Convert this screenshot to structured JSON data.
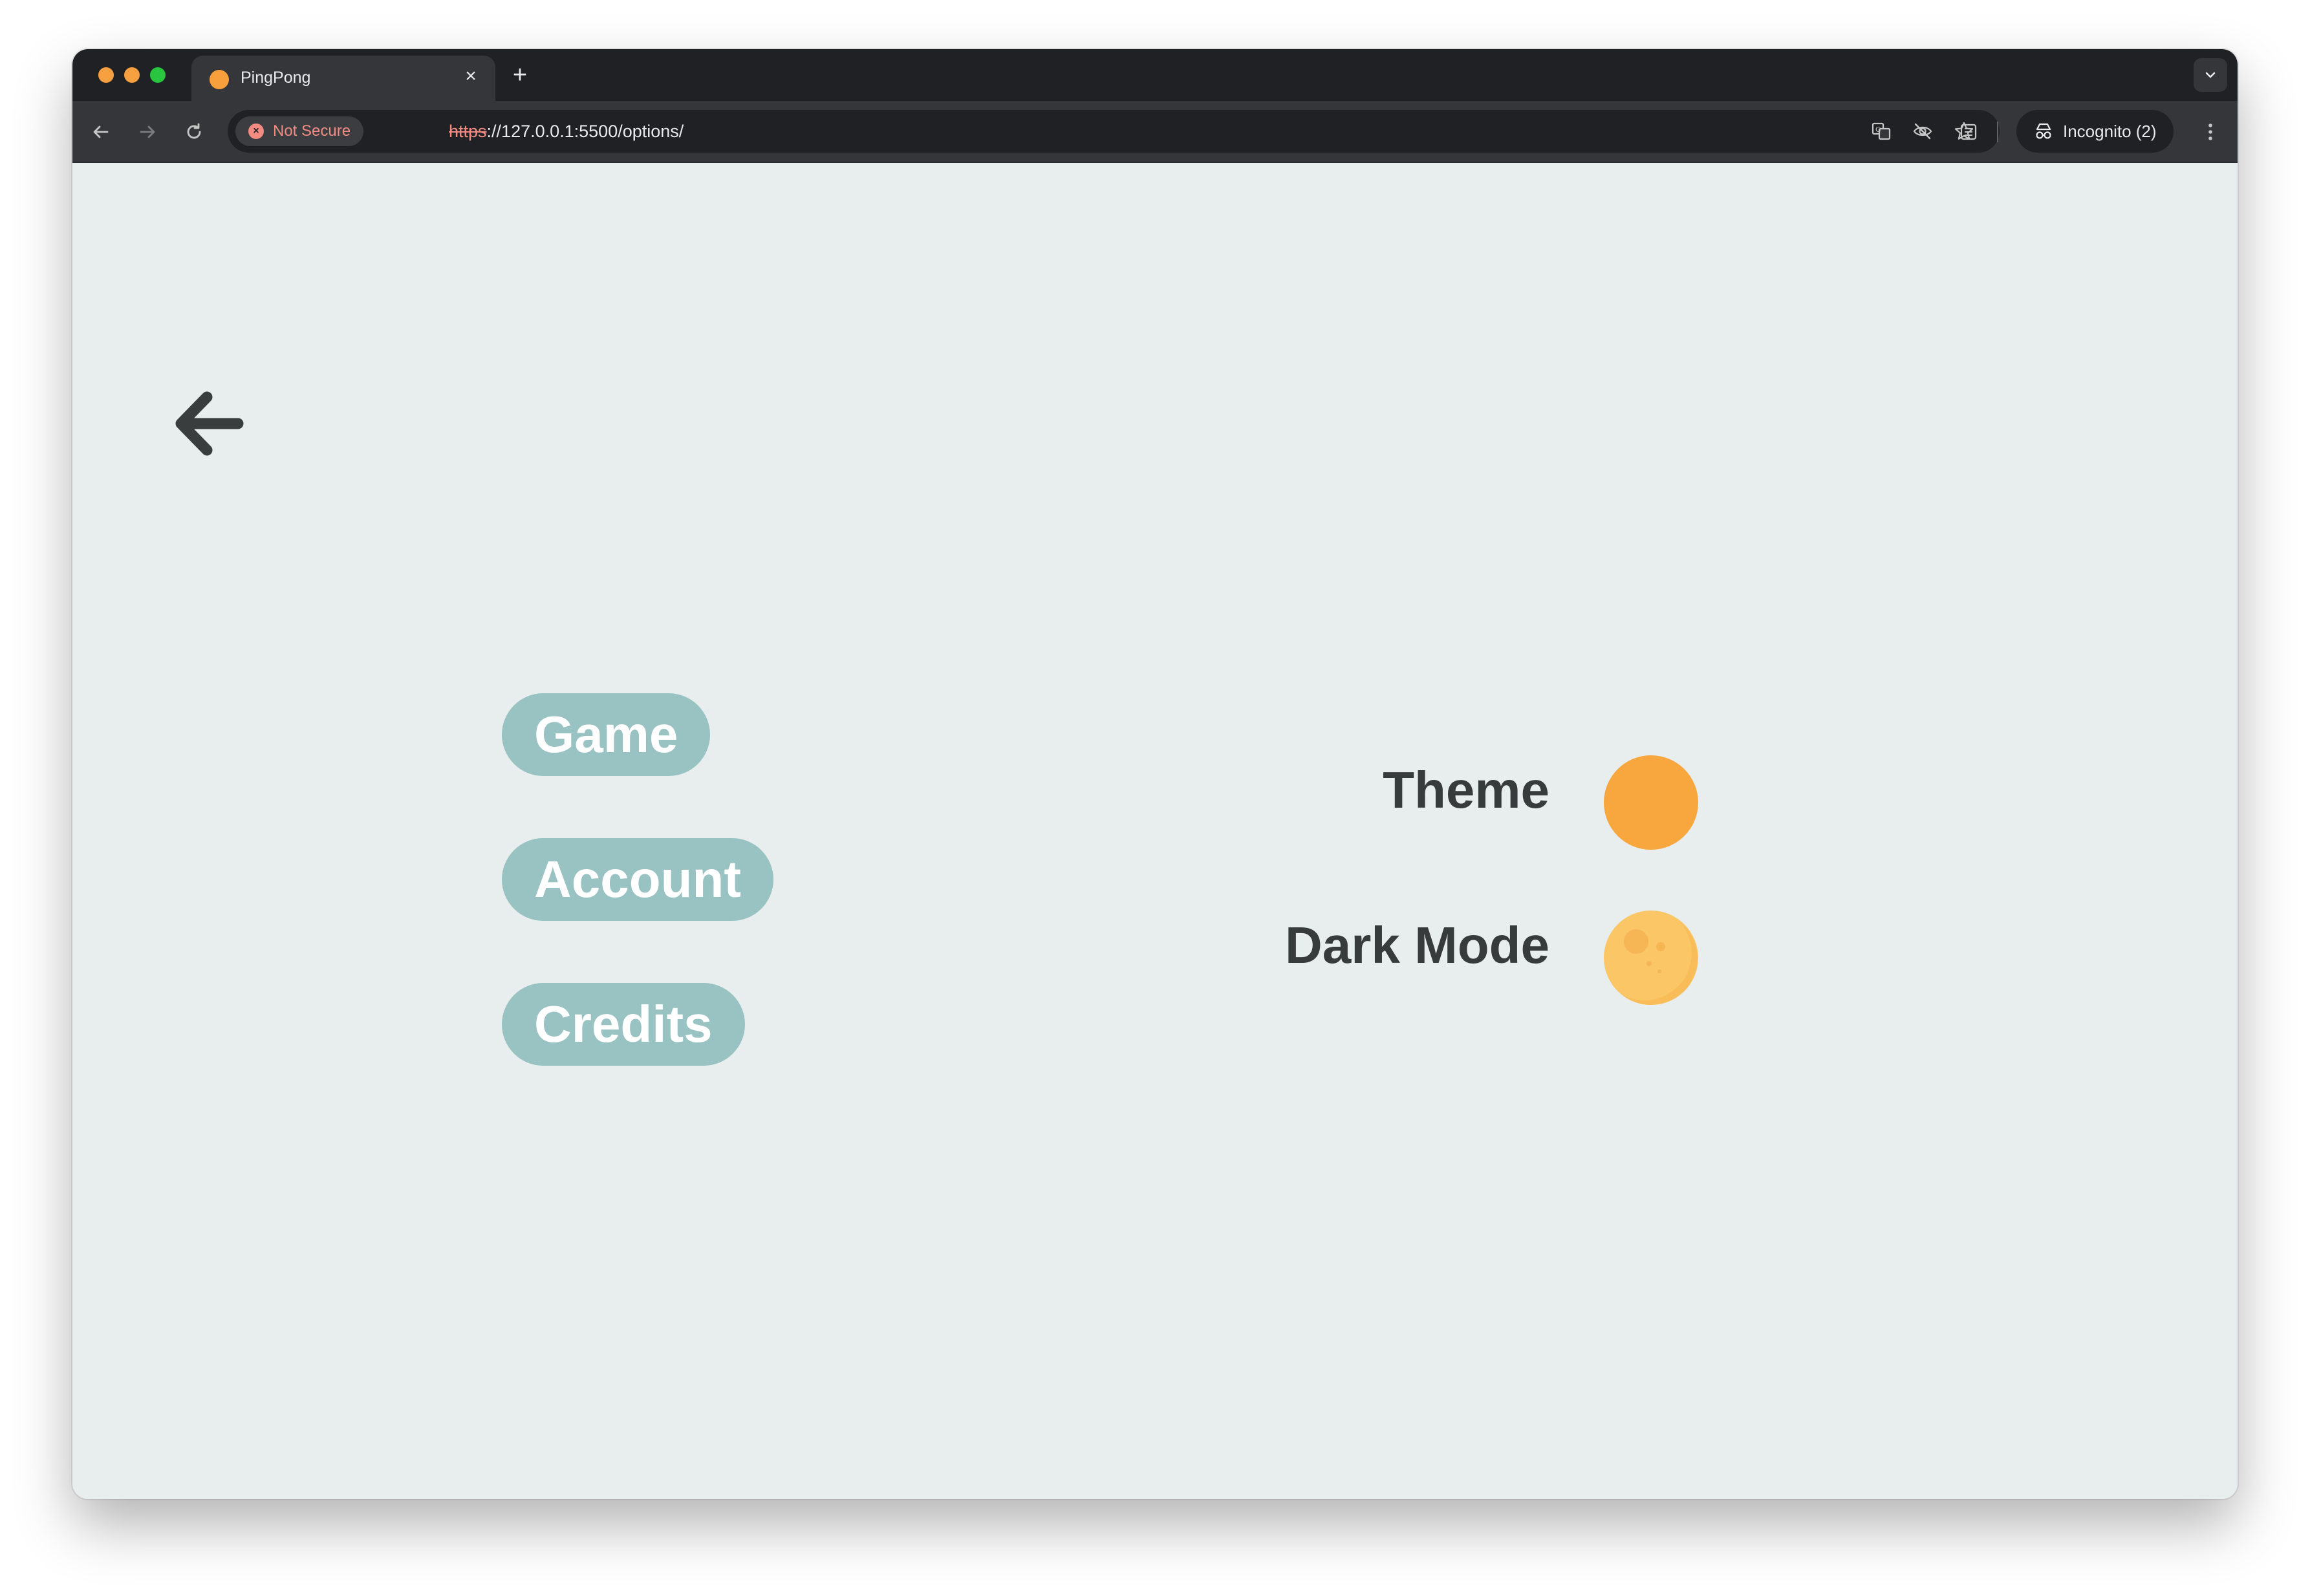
{
  "browser": {
    "tab": {
      "title": "PingPong"
    },
    "address_bar": {
      "security_label": "Not Secure",
      "url_scheme": "https",
      "url_rest": "://127.0.0.1:5500/options/"
    },
    "profile": {
      "label": "Incognito (2)"
    }
  },
  "page": {
    "back": {
      "icon": "arrow-left-icon"
    },
    "menu": {
      "items": [
        {
          "label": "Game"
        },
        {
          "label": "Account"
        },
        {
          "label": "Credits"
        }
      ]
    },
    "settings": {
      "theme": {
        "label": "Theme",
        "color": "#F8A73F"
      },
      "dark_mode": {
        "label": "Dark Mode",
        "icon": "moon-icon",
        "color": "#FBC666"
      }
    }
  },
  "colors": {
    "page_background": "#E8EDED",
    "button_background": "#99C2C2",
    "button_text": "#FFFFFF",
    "label_text": "#383B3C",
    "accent": "#F8A73F"
  }
}
